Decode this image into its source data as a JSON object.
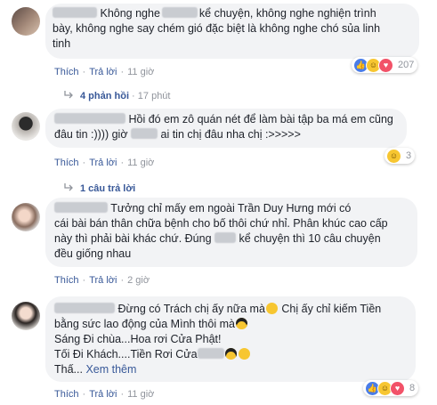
{
  "comments": [
    {
      "lines": [
        "Không nghe",
        "kể chuyện, không nghe nghiện trình",
        "bày, không nghe say chém gió đặc biệt là không nghe chó sủa linh",
        "tinh"
      ],
      "like": "Thích",
      "reply": "Trả lời",
      "time": "11 giờ",
      "reaction_count": "207",
      "replies_label": "4 phản hồi",
      "replies_time": "17 phút"
    },
    {
      "lines": [
        "Hồi đó em zô quán nét để làm bài tập ba má em cũng",
        "đâu tin :)))) giờ",
        "ai tin chị đâu nha chị :>>>>>"
      ],
      "like": "Thích",
      "reply": "Trả lời",
      "time": "11 giờ",
      "reaction_count": "3",
      "replies_label": "1 câu trả lời"
    },
    {
      "lines": [
        "Tưởng chỉ mấy em ngoài Trần Duy Hưng mới có",
        "cái bài bán thân chữa bệnh cho bố thôi chứ nhỉ. Phân khúc cao cấp",
        "này thì phải bài khác chứ. Đúng",
        "kể chuyện thì 10 câu chuyện",
        "đều giống nhau"
      ],
      "like": "Thích",
      "reply": "Trả lời",
      "time": "2 giờ"
    },
    {
      "lines": [
        "Đừng có Trách chị ấy nữa mà",
        "Chị ấy chỉ kiếm Tiền",
        "bằng sức lao động của Mình thôi mà",
        "Sáng Đi chùa...Hoa rơi Cửa Phật!",
        "Tối Đi Khách....Tiền Rơi Cửa",
        "Thấ...",
        "Xem thêm"
      ],
      "like": "Thích",
      "reply": "Trả lời",
      "time": "11 giờ",
      "reaction_count": "8"
    }
  ],
  "icons": {
    "reactions_1": [
      "like-icon",
      "haha-icon",
      "love-icon"
    ],
    "reactions_2": [
      "haha-icon"
    ],
    "reactions_4": [
      "like-icon",
      "haha-icon",
      "love-icon"
    ]
  },
  "colors": {
    "link": "#385898",
    "meta": "#90949c",
    "bubble": "#f2f3f5"
  }
}
